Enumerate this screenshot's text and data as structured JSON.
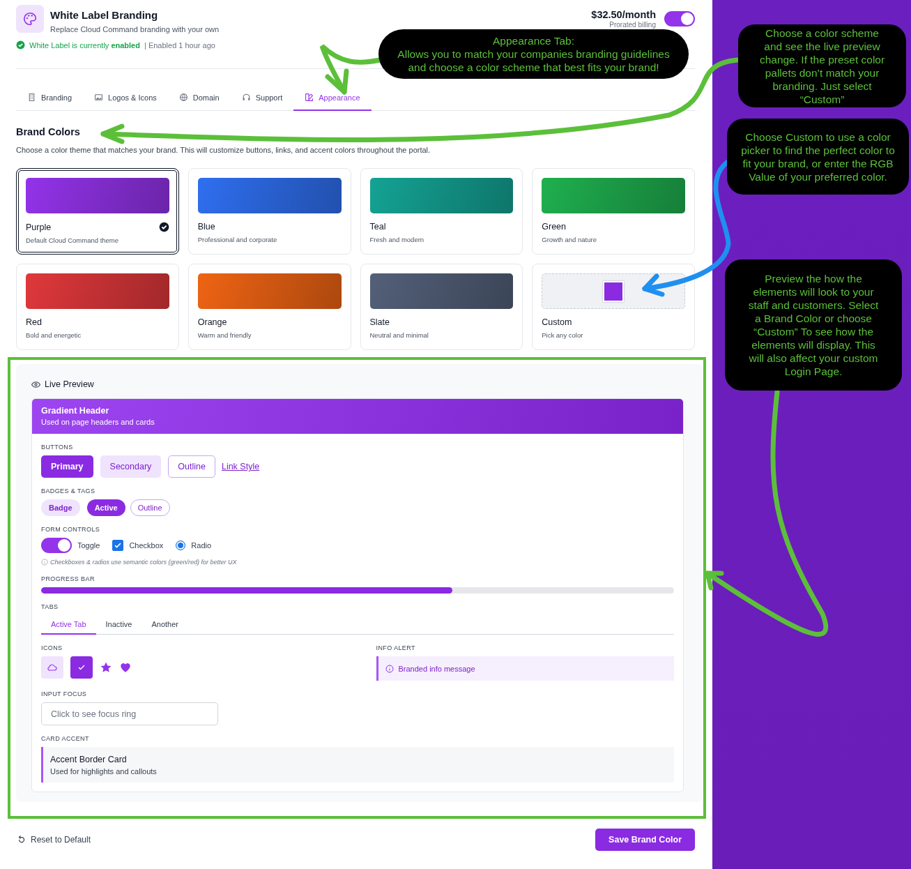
{
  "header": {
    "title": "White Label Branding",
    "subtitle": "Replace Cloud Command branding with your own",
    "price": "$32.50/month",
    "billing_note": "Prorated billing",
    "enabled": true,
    "status": "White Label is currently **enabled**",
    "status_meta": "| Enabled 1 hour ago"
  },
  "tabs": [
    {
      "label": "Branding",
      "kind": "building",
      "selected": false
    },
    {
      "label": "Logos & Icons",
      "kind": "image",
      "selected": false
    },
    {
      "label": "Domain",
      "kind": "globe",
      "selected": false
    },
    {
      "label": "Support",
      "kind": "headset",
      "selected": false
    },
    {
      "label": "Appearance",
      "kind": "palette",
      "selected": true
    }
  ],
  "brand_colors": {
    "title": "Brand Colors",
    "description": "Choose a color theme that matches your brand. This will customize buttons, links, and accent colors throughout the portal.",
    "themes": [
      {
        "kind": "preset",
        "name": "Purple",
        "description": "Default Cloud Command theme",
        "color": "#9333ea",
        "selected": true
      },
      {
        "kind": "preset",
        "name": "Blue",
        "description": "Professional and corporate",
        "color": "#2f6ff0",
        "selected": false
      },
      {
        "kind": "preset",
        "name": "Teal",
        "description": "Fresh and modern",
        "color": "#14a394",
        "selected": false
      },
      {
        "kind": "preset",
        "name": "Green",
        "description": "Growth and nature",
        "color": "#1fb04f",
        "selected": false
      },
      {
        "kind": "preset",
        "name": "Red",
        "description": "Bold and energetic",
        "color": "#e0383b",
        "selected": false
      },
      {
        "kind": "preset",
        "name": "Orange",
        "description": "Warm and friendly",
        "color": "#ef6414",
        "selected": false
      },
      {
        "kind": "preset",
        "name": "Slate",
        "description": "Neutral and minimal",
        "color": "#536079",
        "selected": false
      },
      {
        "kind": "custom",
        "name": "Custom",
        "description": "Pick any color",
        "color": "#8a2be2",
        "selected": false
      }
    ]
  },
  "preview": {
    "title": "Live Preview",
    "header_title": "Gradient Header",
    "header_subtitle": "Used on page headers and cards",
    "buttons_label": "BUTTONS",
    "buttons": [
      {
        "kind": "primary",
        "label": "Primary"
      },
      {
        "kind": "secondary",
        "label": "Secondary"
      },
      {
        "kind": "outline",
        "label": "Outline"
      },
      {
        "kind": "link",
        "label": "Link Style"
      }
    ],
    "badges_label": "BADGES & TAGS",
    "badges": [
      {
        "kind": "soft",
        "label": "Badge"
      },
      {
        "kind": "solid",
        "label": "Active"
      },
      {
        "kind": "outline",
        "label": "Outline"
      }
    ],
    "form_label": "FORM CONTROLS",
    "toggle": {
      "label": "Toggle",
      "on": true
    },
    "checkbox": {
      "label": "Checkbox",
      "checked": true
    },
    "radio": {
      "label": "Radio",
      "selected": true
    },
    "form_note": "Checkboxes & radios use semantic colors (green/red) for better UX",
    "progress_label": "PROGRESS BAR",
    "progress": {
      "level": 0.65
    },
    "tabs_label": "TABS",
    "tabs": [
      {
        "label": "Active Tab",
        "selected": true
      },
      {
        "label": "Inactive",
        "selected": false
      },
      {
        "label": "Another",
        "selected": false
      }
    ],
    "icons_label": "ICONS",
    "alert_label": "INFO ALERT",
    "alert": "Branded info message",
    "input_label": "INPUT FOCUS",
    "input": {
      "placeholder": "Click to see focus ring"
    },
    "card_label": "CARD ACCENT",
    "card_title": "Accent Border Card",
    "card_subtitle": "Used for highlights and callouts"
  },
  "footer": {
    "reset": "Reset to Default",
    "save": "Save Brand Color"
  },
  "annotations": [
    {
      "text": "Appearance Tab:\nAllows you to match your companies branding guidelines and choose a color scheme that best fits your brand!"
    },
    {
      "text": "Choose a color scheme and see the live preview change. If the preset color pallets don’t match your branding. Just select “Custom”"
    },
    {
      "text": "Choose Custom to use a color picker to find the perfect color to fit your brand, or enter the RGB Value of your preferred color."
    },
    {
      "text": "Preview the how the elements will look to your staff and customers. Select a Brand Color or choose “Custom” To see how the elements will display. This will also affect your custom Login Page."
    }
  ]
}
